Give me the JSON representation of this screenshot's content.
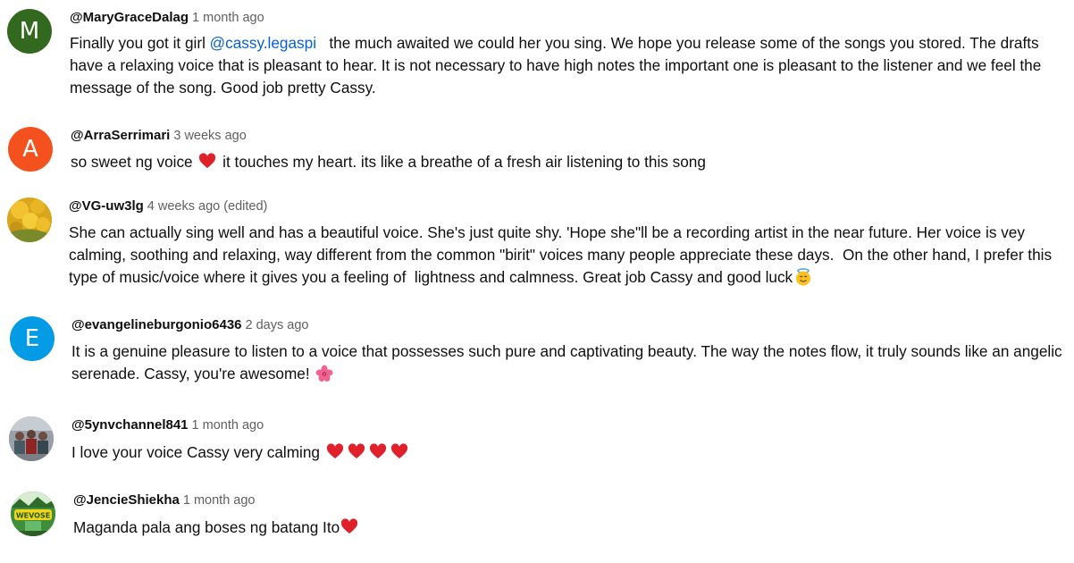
{
  "comments": [
    {
      "avatar": {
        "type": "letter",
        "letter": "M",
        "color": "#33691e"
      },
      "author": "@MaryGraceDalag",
      "time": "1 month ago",
      "text_before": "Finally you got it girl ",
      "mention": "@cassy.legaspi",
      "text_after": "   the much awaited we could her you sing. We hope you release some of the songs you stored. The drafts have a relaxing voice that is pleasant to hear. It is not necessary to have high notes the important one is pleasant to the listener and we feel the message of the song. Good job pretty Cassy."
    },
    {
      "avatar": {
        "type": "letter",
        "letter": "A",
        "color": "#f4511e"
      },
      "author": "@ArraSerrimari",
      "time": "3 weeks ago",
      "text_before": "so sweet ng voice ",
      "emoji": "red-heart",
      "text_after": " it touches my heart. its like a breathe of a fresh air listening to this song"
    },
    {
      "avatar": {
        "type": "image",
        "icon": "tulips-avatar-icon"
      },
      "author": "@VG-uw3lg",
      "time": "4 weeks ago",
      "edited": "(edited)",
      "text": "She can actually sing well and has a beautiful voice. She's just quite shy. 'Hope she\"ll be a recording artist in the near future. Her voice is vey calming, soothing and relaxing, way different from the common \"birit\" voices many people appreciate these days.  On the other hand, I prefer this type of music/voice where it gives you a feeling of  lightness and calmness. Great job Cassy and good luck",
      "emoji": "smiling-face-with-halo"
    },
    {
      "avatar": {
        "type": "letter",
        "letter": "E",
        "color": "#039be5"
      },
      "author": "@evangelineburgonio6436",
      "time": "2 days ago",
      "text": "It is a genuine pleasure to listen to a voice that possesses such pure and captivating beauty. The way the notes flow, it truly sounds like an angelic serenade. Cassy, you're awesome! ",
      "emoji": "hibiscus"
    },
    {
      "avatar": {
        "type": "image",
        "icon": "group-photo-avatar-icon"
      },
      "author": "@5ynvchannel841",
      "time": "1 month ago",
      "text": "I love your voice Cassy very calming ",
      "emoji": "red-heart",
      "emoji_count": 4
    },
    {
      "avatar": {
        "type": "image",
        "icon": "channel-logo-avatar-icon",
        "label": "WEVOSE"
      },
      "author": "@JencieShiekha",
      "time": "1 month ago",
      "text": "Maganda pala ang boses ng batang Ito",
      "emoji": "red-heart"
    }
  ]
}
